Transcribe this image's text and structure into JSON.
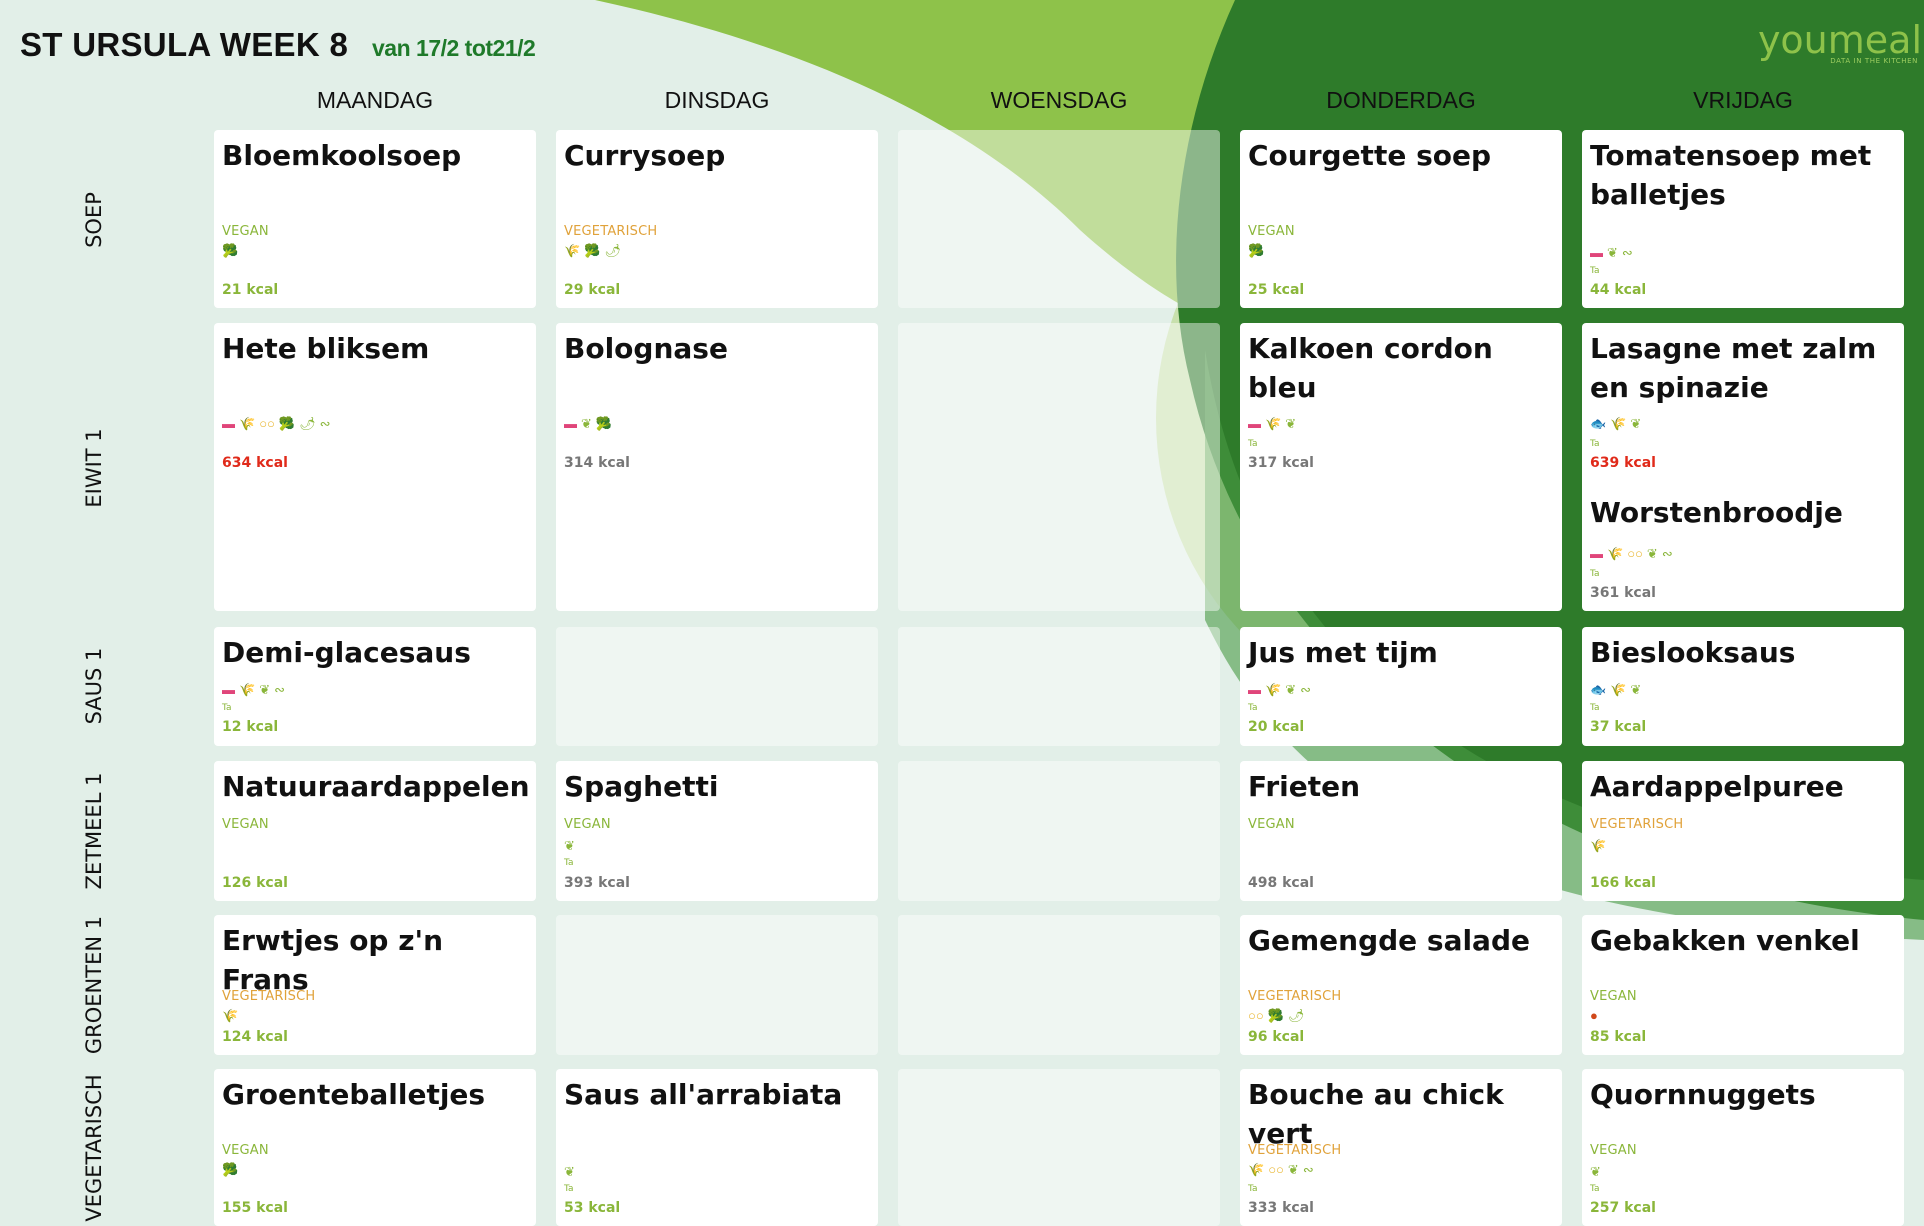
{
  "header": {
    "title": "ST URSULA WEEK 8",
    "subtitle": "van 17/2 tot21/2"
  },
  "logo": {
    "word": "youmeal",
    "tagline": "DATA IN THE KITCHEN"
  },
  "days": [
    "MAANDAG",
    "DINSDAG",
    "WOENSDAG",
    "DONDERDAG",
    "VRIJDAG"
  ],
  "rows": [
    "SOEP",
    "EIWIT 1",
    "SAUS 1",
    "ZETMEEL 1",
    "GROENTEN 1",
    "VEGETARISCH"
  ],
  "colors": {
    "vegan": "#8ab63a",
    "vegetarisch": "#e0a23a",
    "kcal_normal": "#8ab63a",
    "kcal_high": "#e02a1a",
    "kcal_medium": "#777777",
    "background": "#e2efe8",
    "light_green": "#8ec24a",
    "dark_green": "#2e7b2a"
  },
  "icon_legend": {
    "milk-icon": "pink",
    "gluten-icon": "orange",
    "egg-icon": "yellow",
    "celery-icon": "green",
    "mustard-icon": "green",
    "soy-icon": "green",
    "fish-icon": "blue",
    "nuts-icon": "red"
  },
  "menu": {
    "soep": {
      "maandag": {
        "dish": "Bloemkoolsoep",
        "tag": "VEGAN",
        "icons": [
          "celery-icon"
        ],
        "kcal": "21 kcal"
      },
      "dinsdag": {
        "dish": "Currysoep",
        "tag": "VEGETARISCH",
        "icons": [
          "gluten-icon",
          "celery-icon",
          "mustard-icon"
        ],
        "kcal": "29 kcal"
      },
      "donderdag": {
        "dish": "Courgette soep",
        "tag": "VEGAN",
        "icons": [
          "celery-icon"
        ],
        "kcal": "25 kcal"
      },
      "vrijdag": {
        "dish": "Tomatensoep met balletjes",
        "icons": [
          "milk-icon",
          "soy-icon",
          "sulphite-icon"
        ],
        "ta": "Ta",
        "kcal": "44 kcal"
      }
    },
    "eiwit": {
      "maandag": {
        "dish": "Hete bliksem",
        "icons": [
          "milk-icon",
          "gluten-icon",
          "egg-icon",
          "celery-icon",
          "mustard-icon",
          "sulphite-icon"
        ],
        "kcal": "634 kcal"
      },
      "dinsdag": {
        "dish": "Bolognase",
        "icons": [
          "milk-icon",
          "soy-icon",
          "celery-icon"
        ],
        "kcal": "314 kcal"
      },
      "donderdag": {
        "dish": "Kalkoen cordon bleu",
        "icons": [
          "milk-icon",
          "gluten-icon",
          "soy-icon"
        ],
        "ta": "Ta",
        "kcal": "317 kcal"
      },
      "vrijdag": {
        "dish": "Lasagne met zalm en spinazie",
        "icons": [
          "fish-icon",
          "gluten-icon",
          "soy-icon"
        ],
        "ta": "Ta",
        "kcal": "639 kcal"
      },
      "vrijdag2": {
        "dish": "Worstenbroodje",
        "icons": [
          "milk-icon",
          "gluten-icon",
          "egg-icon",
          "soy-icon",
          "sulphite-icon"
        ],
        "ta": "Ta",
        "kcal": "361 kcal"
      }
    },
    "saus": {
      "maandag": {
        "dish": "Demi-glacesaus",
        "icons": [
          "milk-icon",
          "gluten-icon",
          "soy-icon",
          "sulphite-icon"
        ],
        "ta": "Ta",
        "kcal": "12 kcal"
      },
      "donderdag": {
        "dish": "Jus met tijm",
        "icons": [
          "milk-icon",
          "gluten-icon",
          "soy-icon",
          "sulphite-icon"
        ],
        "ta": "Ta",
        "kcal": "20 kcal"
      },
      "vrijdag": {
        "dish": "Bieslooksaus",
        "icons": [
          "fish-icon",
          "gluten-icon",
          "soy-icon"
        ],
        "ta": "Ta",
        "kcal": "37 kcal"
      }
    },
    "zetmeel": {
      "maandag": {
        "dish": "Natuuraardappelen",
        "tag": "VEGAN",
        "kcal": "126 kcal"
      },
      "dinsdag": {
        "dish": "Spaghetti",
        "tag": "VEGAN",
        "icons": [
          "soy-icon"
        ],
        "ta": "Ta",
        "kcal": "393 kcal"
      },
      "donderdag": {
        "dish": "Frieten",
        "tag": "VEGAN",
        "kcal": "498 kcal"
      },
      "vrijdag": {
        "dish": "Aardappelpuree",
        "tag": "VEGETARISCH",
        "icons": [
          "gluten-icon"
        ],
        "kcal": "166 kcal"
      }
    },
    "groenten": {
      "maandag": {
        "dish": "Erwtjes op z'n Frans",
        "tag": "VEGETARISCH",
        "icons": [
          "gluten-icon"
        ],
        "kcal": "124 kcal"
      },
      "donderdag": {
        "dish": "Gemengde salade",
        "tag": "VEGETARISCH",
        "icons": [
          "egg-icon",
          "celery-icon",
          "mustard-icon"
        ],
        "kcal": "96 kcal"
      },
      "vrijdag": {
        "dish": "Gebakken venkel",
        "tag": "VEGAN",
        "icons": [
          "nuts-icon"
        ],
        "kcal": "85 kcal"
      }
    },
    "vegetarisch": {
      "maandag": {
        "dish": "Groenteballetjes",
        "tag": "VEGAN",
        "icons": [
          "celery-icon"
        ],
        "kcal": "155 kcal"
      },
      "dinsdag": {
        "dish": "Saus all'arrabiata",
        "icons": [
          "soy-icon"
        ],
        "ta": "Ta",
        "kcal": "53 kcal"
      },
      "donderdag": {
        "dish": "Bouche au chick vert",
        "tag": "VEGETARISCH",
        "icons": [
          "gluten-icon",
          "egg-icon",
          "soy-icon",
          "sulphite-icon"
        ],
        "ta": "Ta",
        "kcal": "333 kcal"
      },
      "vrijdag": {
        "dish": "Quornnuggets",
        "tag": "VEGAN",
        "icons": [
          "soy-icon"
        ],
        "ta": "Ta",
        "kcal": "257 kcal"
      }
    }
  }
}
